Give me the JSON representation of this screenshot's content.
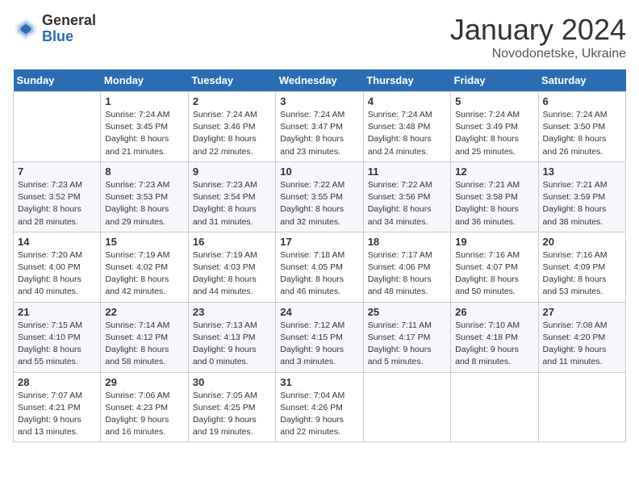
{
  "header": {
    "logo_general": "General",
    "logo_blue": "Blue",
    "month_title": "January 2024",
    "location": "Novodonetske, Ukraine"
  },
  "days_of_week": [
    "Sunday",
    "Monday",
    "Tuesday",
    "Wednesday",
    "Thursday",
    "Friday",
    "Saturday"
  ],
  "weeks": [
    [
      {
        "day": "",
        "sunrise": "",
        "sunset": "",
        "daylight": ""
      },
      {
        "day": "1",
        "sunrise": "Sunrise: 7:24 AM",
        "sunset": "Sunset: 3:45 PM",
        "daylight": "Daylight: 8 hours and 21 minutes."
      },
      {
        "day": "2",
        "sunrise": "Sunrise: 7:24 AM",
        "sunset": "Sunset: 3:46 PM",
        "daylight": "Daylight: 8 hours and 22 minutes."
      },
      {
        "day": "3",
        "sunrise": "Sunrise: 7:24 AM",
        "sunset": "Sunset: 3:47 PM",
        "daylight": "Daylight: 8 hours and 23 minutes."
      },
      {
        "day": "4",
        "sunrise": "Sunrise: 7:24 AM",
        "sunset": "Sunset: 3:48 PM",
        "daylight": "Daylight: 8 hours and 24 minutes."
      },
      {
        "day": "5",
        "sunrise": "Sunrise: 7:24 AM",
        "sunset": "Sunset: 3:49 PM",
        "daylight": "Daylight: 8 hours and 25 minutes."
      },
      {
        "day": "6",
        "sunrise": "Sunrise: 7:24 AM",
        "sunset": "Sunset: 3:50 PM",
        "daylight": "Daylight: 8 hours and 26 minutes."
      }
    ],
    [
      {
        "day": "7",
        "sunrise": "Sunrise: 7:23 AM",
        "sunset": "Sunset: 3:52 PM",
        "daylight": "Daylight: 8 hours and 28 minutes."
      },
      {
        "day": "8",
        "sunrise": "Sunrise: 7:23 AM",
        "sunset": "Sunset: 3:53 PM",
        "daylight": "Daylight: 8 hours and 29 minutes."
      },
      {
        "day": "9",
        "sunrise": "Sunrise: 7:23 AM",
        "sunset": "Sunset: 3:54 PM",
        "daylight": "Daylight: 8 hours and 31 minutes."
      },
      {
        "day": "10",
        "sunrise": "Sunrise: 7:22 AM",
        "sunset": "Sunset: 3:55 PM",
        "daylight": "Daylight: 8 hours and 32 minutes."
      },
      {
        "day": "11",
        "sunrise": "Sunrise: 7:22 AM",
        "sunset": "Sunset: 3:56 PM",
        "daylight": "Daylight: 8 hours and 34 minutes."
      },
      {
        "day": "12",
        "sunrise": "Sunrise: 7:21 AM",
        "sunset": "Sunset: 3:58 PM",
        "daylight": "Daylight: 8 hours and 36 minutes."
      },
      {
        "day": "13",
        "sunrise": "Sunrise: 7:21 AM",
        "sunset": "Sunset: 3:59 PM",
        "daylight": "Daylight: 8 hours and 38 minutes."
      }
    ],
    [
      {
        "day": "14",
        "sunrise": "Sunrise: 7:20 AM",
        "sunset": "Sunset: 4:00 PM",
        "daylight": "Daylight: 8 hours and 40 minutes."
      },
      {
        "day": "15",
        "sunrise": "Sunrise: 7:19 AM",
        "sunset": "Sunset: 4:02 PM",
        "daylight": "Daylight: 8 hours and 42 minutes."
      },
      {
        "day": "16",
        "sunrise": "Sunrise: 7:19 AM",
        "sunset": "Sunset: 4:03 PM",
        "daylight": "Daylight: 8 hours and 44 minutes."
      },
      {
        "day": "17",
        "sunrise": "Sunrise: 7:18 AM",
        "sunset": "Sunset: 4:05 PM",
        "daylight": "Daylight: 8 hours and 46 minutes."
      },
      {
        "day": "18",
        "sunrise": "Sunrise: 7:17 AM",
        "sunset": "Sunset: 4:06 PM",
        "daylight": "Daylight: 8 hours and 48 minutes."
      },
      {
        "day": "19",
        "sunrise": "Sunrise: 7:16 AM",
        "sunset": "Sunset: 4:07 PM",
        "daylight": "Daylight: 8 hours and 50 minutes."
      },
      {
        "day": "20",
        "sunrise": "Sunrise: 7:16 AM",
        "sunset": "Sunset: 4:09 PM",
        "daylight": "Daylight: 8 hours and 53 minutes."
      }
    ],
    [
      {
        "day": "21",
        "sunrise": "Sunrise: 7:15 AM",
        "sunset": "Sunset: 4:10 PM",
        "daylight": "Daylight: 8 hours and 55 minutes."
      },
      {
        "day": "22",
        "sunrise": "Sunrise: 7:14 AM",
        "sunset": "Sunset: 4:12 PM",
        "daylight": "Daylight: 8 hours and 58 minutes."
      },
      {
        "day": "23",
        "sunrise": "Sunrise: 7:13 AM",
        "sunset": "Sunset: 4:13 PM",
        "daylight": "Daylight: 9 hours and 0 minutes."
      },
      {
        "day": "24",
        "sunrise": "Sunrise: 7:12 AM",
        "sunset": "Sunset: 4:15 PM",
        "daylight": "Daylight: 9 hours and 3 minutes."
      },
      {
        "day": "25",
        "sunrise": "Sunrise: 7:11 AM",
        "sunset": "Sunset: 4:17 PM",
        "daylight": "Daylight: 9 hours and 5 minutes."
      },
      {
        "day": "26",
        "sunrise": "Sunrise: 7:10 AM",
        "sunset": "Sunset: 4:18 PM",
        "daylight": "Daylight: 9 hours and 8 minutes."
      },
      {
        "day": "27",
        "sunrise": "Sunrise: 7:08 AM",
        "sunset": "Sunset: 4:20 PM",
        "daylight": "Daylight: 9 hours and 11 minutes."
      }
    ],
    [
      {
        "day": "28",
        "sunrise": "Sunrise: 7:07 AM",
        "sunset": "Sunset: 4:21 PM",
        "daylight": "Daylight: 9 hours and 13 minutes."
      },
      {
        "day": "29",
        "sunrise": "Sunrise: 7:06 AM",
        "sunset": "Sunset: 4:23 PM",
        "daylight": "Daylight: 9 hours and 16 minutes."
      },
      {
        "day": "30",
        "sunrise": "Sunrise: 7:05 AM",
        "sunset": "Sunset: 4:25 PM",
        "daylight": "Daylight: 9 hours and 19 minutes."
      },
      {
        "day": "31",
        "sunrise": "Sunrise: 7:04 AM",
        "sunset": "Sunset: 4:26 PM",
        "daylight": "Daylight: 9 hours and 22 minutes."
      },
      {
        "day": "",
        "sunrise": "",
        "sunset": "",
        "daylight": ""
      },
      {
        "day": "",
        "sunrise": "",
        "sunset": "",
        "daylight": ""
      },
      {
        "day": "",
        "sunrise": "",
        "sunset": "",
        "daylight": ""
      }
    ]
  ]
}
